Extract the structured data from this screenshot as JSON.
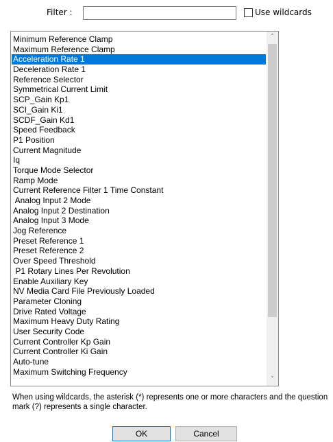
{
  "filter": {
    "label": "Filter :",
    "value": "",
    "wildcards_label": "Use wildcards",
    "wildcards_checked": false
  },
  "list": {
    "selected_index": 2,
    "items": [
      "Minimum Reference Clamp",
      "Maximum Reference Clamp",
      "Acceleration Rate 1",
      "Deceleration Rate 1",
      "Reference Selector",
      "Symmetrical Current Limit",
      "SCP_Gain Kp1",
      "SCI_Gain Ki1",
      "SCDF_Gain Kd1",
      "Speed Feedback",
      "P1 Position",
      "Current Magnitude",
      "Iq",
      "Torque Mode Selector",
      "Ramp Mode",
      "Current Reference Filter 1 Time Constant",
      " Analog Input 2 Mode",
      "Analog Input 2 Destination",
      "Analog Input 3 Mode",
      "Jog Reference",
      "Preset Reference 1",
      "Preset Reference 2",
      "Over Speed Threshold",
      " P1 Rotary Lines Per Revolution",
      "Enable Auxiliary Key",
      "NV Media Card File Previously Loaded",
      "Parameter Cloning",
      "Drive Rated Voltage",
      "Maximum Heavy Duty Rating",
      "User Security Code",
      "Current Controller Kp Gain",
      "Current Controller Ki Gain",
      "Auto-tune",
      "Maximum Switching Frequency"
    ]
  },
  "icons": {
    "scroll_up": "chevron-up-icon",
    "scroll_down": "chevron-down-icon"
  },
  "hint": "When using wildcards, the asterisk (*) represents one or more characters and the question mark (?) represents a single character.",
  "buttons": {
    "ok": "OK",
    "cancel": "Cancel"
  },
  "colors": {
    "selection": "#0078d7"
  }
}
